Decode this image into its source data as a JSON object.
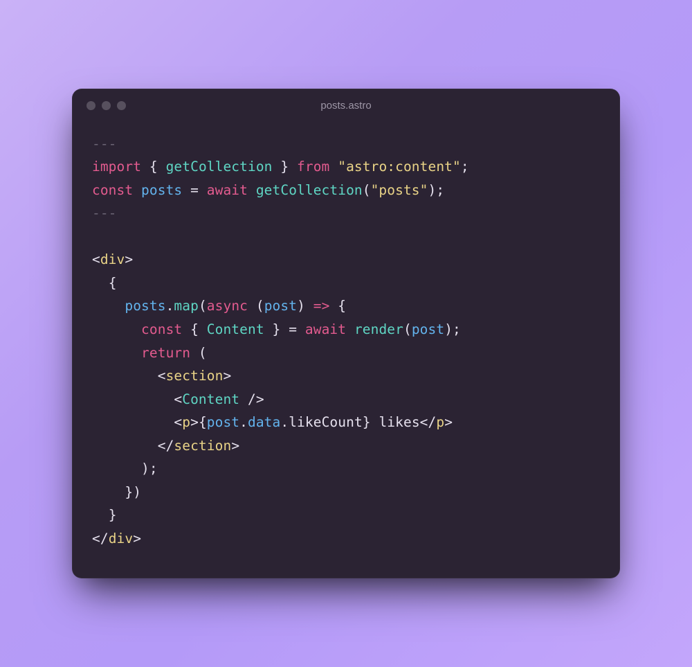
{
  "window": {
    "title": "posts.astro"
  },
  "code": {
    "l1": {
      "dashes": "---"
    },
    "l2": {
      "import": "import",
      "lb": "{ ",
      "fn": "getCollection",
      "rb": " }",
      "from": "from",
      "str": "\"astro:content\"",
      "semi": ";"
    },
    "l3": {
      "const": "const",
      "posts": "posts",
      "eq": " = ",
      "await": "await",
      "fn": "getCollection",
      "lp": "(",
      "str": "\"posts\"",
      "rp": ");"
    },
    "l4": {
      "dashes": "---"
    },
    "l6": {
      "lt": "<",
      "tag": "div",
      "gt": ">"
    },
    "l7": {
      "ind": "  ",
      "brace": "{"
    },
    "l8": {
      "ind": "    ",
      "posts": "posts",
      "dot": ".",
      "map": "map",
      "lp": "(",
      "async": "async",
      "sp": " ",
      "lp2": "(",
      "post": "post",
      "rp2": ")",
      "arrow": " => ",
      "lb": "{"
    },
    "l9": {
      "ind": "      ",
      "const": "const",
      "lb": " { ",
      "Content": "Content",
      "rb": " } ",
      "eq": "= ",
      "await": "await",
      "sp": " ",
      "render": "render",
      "lp": "(",
      "post": "post",
      "rp": ");"
    },
    "l10": {
      "ind": "      ",
      "return": "return",
      "lp": " ("
    },
    "l11": {
      "ind": "        ",
      "lt": "<",
      "tag": "section",
      "gt": ">"
    },
    "l12": {
      "ind": "          ",
      "lt": "<",
      "Content": "Content",
      "slashgt": " />"
    },
    "l13": {
      "ind": "          ",
      "lt": "<",
      "p": "p",
      "gt": ">",
      "lb": "{",
      "post": "post",
      "dot1": ".",
      "data": "data",
      "dot2": ".",
      "like": "likeCount",
      "rb": "}",
      "txt": " likes",
      "lt2": "</",
      "p2": "p",
      "gt2": ">"
    },
    "l14": {
      "ind": "        ",
      "lt": "</",
      "tag": "section",
      "gt": ">"
    },
    "l15": {
      "ind": "      ",
      "rp": ");"
    },
    "l16": {
      "ind": "    ",
      "rb": "})"
    },
    "l17": {
      "ind": "  ",
      "brace": "}"
    },
    "l18": {
      "lt": "</",
      "tag": "div",
      "gt": ">"
    }
  }
}
